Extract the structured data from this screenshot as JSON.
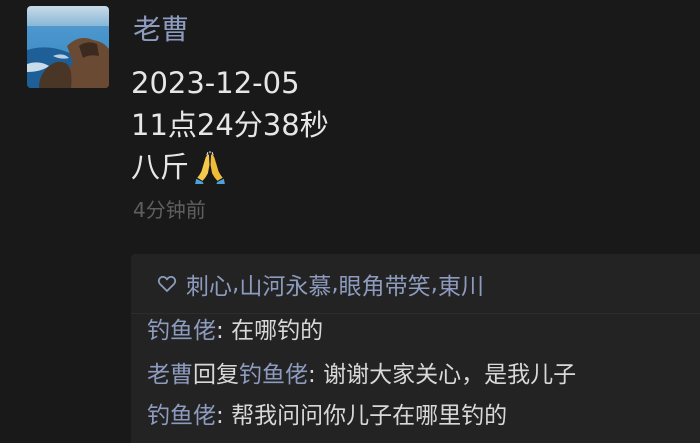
{
  "post": {
    "author": "老曹",
    "lines": [
      "2023-12-05",
      "11点24分38秒",
      "八斤"
    ],
    "emoji": "folded-hands-emoji",
    "time_ago": "4分钟前"
  },
  "likes": {
    "icon": "heart-outline-icon",
    "names": [
      "刺心",
      "山河永慕",
      "眼角带笑",
      "東川"
    ],
    "separator": ", "
  },
  "comments": [
    {
      "author": "钓鱼佬",
      "separator": ": ",
      "text": "在哪钓的"
    },
    {
      "author": "老曹",
      "reply_word": "回复",
      "reply_to": "钓鱼佬",
      "separator": ": ",
      "text": "谢谢大家关心，是我儿子"
    },
    {
      "author": "钓鱼佬",
      "separator": ": ",
      "text": "帮我问问你儿子在哪里钓的"
    }
  ],
  "colors": {
    "background": "#191919",
    "comment_box": "#232323",
    "name_link": "#8d9bbe",
    "text": "#e6e6e6",
    "muted": "#5f5f5f"
  }
}
